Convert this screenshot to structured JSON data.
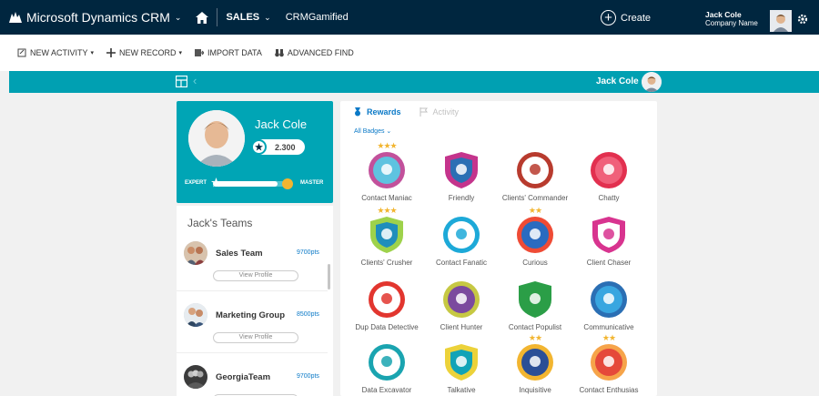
{
  "topnav": {
    "brand": "Microsoft Dynamics CRM",
    "area": "SALES",
    "app_name": "CRMGamified",
    "create_label": "Create",
    "user_name": "Jack Cole",
    "company": "Company Name"
  },
  "commands": [
    {
      "label": "NEW ACTIVITY",
      "icon": "activity-icon",
      "has_menu": true
    },
    {
      "label": "NEW RECORD",
      "icon": "plus-icon",
      "has_menu": true
    },
    {
      "label": "IMPORT DATA",
      "icon": "import-icon",
      "has_menu": false
    },
    {
      "label": "ADVANCED FIND",
      "icon": "binoculars-icon",
      "has_menu": false
    }
  ],
  "strip": {
    "user_name": "Jack Cole"
  },
  "profile": {
    "name": "Jack Cole",
    "points": "2.300",
    "level_from": "EXPERT",
    "level_to": "MASTER",
    "progress": 0.82
  },
  "teams": {
    "title": "Jack's Teams",
    "view_label": "View Profile",
    "items": [
      {
        "name": "Sales Team",
        "points": "9700pts"
      },
      {
        "name": "Marketing Group",
        "points": "8500pts"
      },
      {
        "name": "GeorgiaTeam",
        "points": "9700pts"
      }
    ]
  },
  "rewards": {
    "tab_rewards": "Rewards",
    "tab_activity": "Activity",
    "filter_label": "All Badges",
    "badges": [
      {
        "label": "Contact Maniac",
        "stars": 3,
        "color": "#c2519b",
        "inner": "#5ec3e0"
      },
      {
        "label": "Friendly",
        "stars": 0,
        "color": "#c4348c",
        "inner": "#2b6fb4"
      },
      {
        "label": "Clients' Commander",
        "stars": 0,
        "color": "#b83b2e",
        "inner": "#ffffff"
      },
      {
        "label": "Chatty",
        "stars": 0,
        "color": "#e2304f",
        "inner": "#f0607a"
      },
      {
        "label": "Clients' Crusher",
        "stars": 3,
        "color": "#9ed24b",
        "inner": "#1f8ebc"
      },
      {
        "label": "Contact Fanatic",
        "stars": 0,
        "color": "#1da9d8",
        "inner": "#ffffff"
      },
      {
        "label": "Curious",
        "stars": 2,
        "color": "#ef4b35",
        "inner": "#2a6bc0"
      },
      {
        "label": "Client Chaser",
        "stars": 0,
        "color": "#d8348f",
        "inner": "#ffffff"
      },
      {
        "label": "Dup Data Detective",
        "stars": 0,
        "color": "#e2362f",
        "inner": "#ffffff"
      },
      {
        "label": "Client Hunter",
        "stars": 0,
        "color": "#c6c843",
        "inner": "#7b4a9e"
      },
      {
        "label": "Contact Populist",
        "stars": 0,
        "color": "#2b9e47",
        "inner": "#2b9e47"
      },
      {
        "label": "Communicative",
        "stars": 0,
        "color": "#2b6fb4",
        "inner": "#39a6e0"
      },
      {
        "label": "Data Excavator",
        "stars": 0,
        "color": "#1aa4b0",
        "inner": "#ffffff"
      },
      {
        "label": "Talkative",
        "stars": 0,
        "color": "#ecd23a",
        "inner": "#11a3b7"
      },
      {
        "label": "Inquisitive",
        "stars": 2,
        "color": "#f2b530",
        "inner": "#2b4f96"
      },
      {
        "label": "Contact Enthusias",
        "stars": 2,
        "color": "#f6a44a",
        "inner": "#e5493a"
      }
    ]
  },
  "colors": {
    "nav_bg": "#00263f",
    "teal": "#00a0b2",
    "link": "#0a79c7",
    "gold": "#f2b530"
  }
}
